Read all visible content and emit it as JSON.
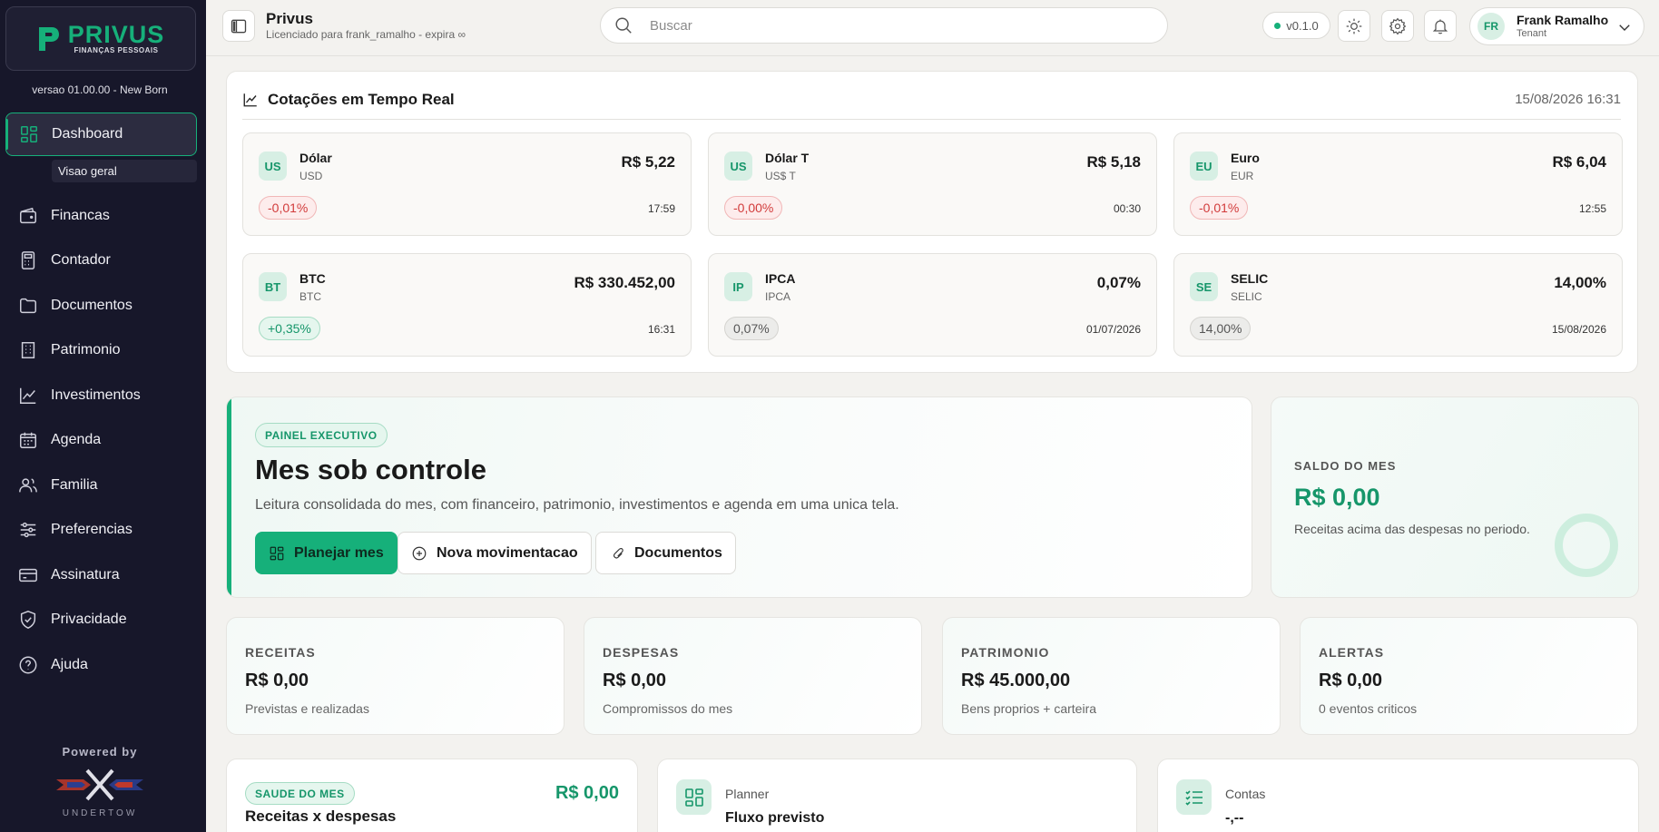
{
  "brand": {
    "logo_title": "PRIVUS",
    "logo_subtitle": "FINANÇAS PESSOAIS",
    "version_label": "versao 01.00.00 - New Born",
    "accent_color": "#16b07a"
  },
  "sidebar": {
    "active_item": "Dashboard",
    "subitem": "Visao geral",
    "items": [
      {
        "label": "Financas",
        "icon": "wallet-icon"
      },
      {
        "label": "Contador",
        "icon": "calculator-icon"
      },
      {
        "label": "Documentos",
        "icon": "folder-icon"
      },
      {
        "label": "Patrimonio",
        "icon": "building-icon"
      },
      {
        "label": "Investimentos",
        "icon": "chart-line-icon"
      },
      {
        "label": "Agenda",
        "icon": "calendar-icon"
      },
      {
        "label": "Familia",
        "icon": "users-icon"
      },
      {
        "label": "Preferencias",
        "icon": "sliders-icon"
      },
      {
        "label": "Assinatura",
        "icon": "credit-card-icon"
      },
      {
        "label": "Privacidade",
        "icon": "shield-check-icon"
      },
      {
        "label": "Ajuda",
        "icon": "help-circle-icon"
      }
    ],
    "powered_by": "Powered by",
    "powered_brand": "UNDERTOW"
  },
  "header": {
    "app_name": "Privus",
    "license": "Licenciado para frank_ramalho - expira ∞",
    "search_placeholder": "Buscar",
    "version": "v0.1.0",
    "user": {
      "initials": "FR",
      "name": "Frank Ramalho",
      "role": "Tenant"
    }
  },
  "quotes": {
    "title": "Cotações em Tempo Real",
    "timestamp": "15/08/2026 16:31",
    "items": [
      {
        "badge": "US",
        "name": "Dólar",
        "code": "USD",
        "value": "R$ 5,22",
        "change": "-0,01%",
        "trend": "neg",
        "time": "17:59"
      },
      {
        "badge": "US",
        "name": "Dólar T",
        "code": "US$ T",
        "value": "R$ 5,18",
        "change": "-0,00%",
        "trend": "neg",
        "time": "00:30"
      },
      {
        "badge": "EU",
        "name": "Euro",
        "code": "EUR",
        "value": "R$ 6,04",
        "change": "-0,01%",
        "trend": "neg",
        "time": "12:55"
      },
      {
        "badge": "BT",
        "name": "BTC",
        "code": "BTC",
        "value": "R$ 330.452,00",
        "change": "+0,35%",
        "trend": "pos",
        "time": "16:31"
      },
      {
        "badge": "IP",
        "name": "IPCA",
        "code": "IPCA",
        "value": "0,07%",
        "change": "0,07%",
        "trend": "neu",
        "time": "01/07/2026"
      },
      {
        "badge": "SE",
        "name": "SELIC",
        "code": "SELIC",
        "value": "14,00%",
        "change": "14,00%",
        "trend": "neu",
        "time": "15/08/2026"
      }
    ]
  },
  "executive": {
    "tag": "PAINEL EXECUTIVO",
    "title": "Mes sob controle",
    "description": "Leitura consolidada do mes, com financeiro, patrimonio, investimentos e agenda em uma unica tela.",
    "buttons": {
      "plan": "Planejar mes",
      "new": "Nova movimentacao",
      "docs": "Documentos"
    }
  },
  "saldo": {
    "label": "SALDO DO MES",
    "value": "R$ 0,00",
    "description": "Receitas acima das despesas no periodo."
  },
  "stats": [
    {
      "label": "RECEITAS",
      "value": "R$ 0,00",
      "description": "Previstas e realizadas"
    },
    {
      "label": "DESPESAS",
      "value": "R$ 0,00",
      "description": "Compromissos do mes"
    },
    {
      "label": "PATRIMONIO",
      "value": "R$ 45.000,00",
      "description": "Bens proprios + carteira"
    },
    {
      "label": "ALERTAS",
      "value": "R$ 0,00",
      "description": "0 eventos criticos"
    }
  ],
  "bottom": {
    "health": {
      "tag": "SAUDE DO MES",
      "title": "Receitas x despesas",
      "value": "R$ 0,00"
    },
    "planner": {
      "small": "Planner",
      "big": "Fluxo previsto"
    },
    "contas": {
      "small": "Contas",
      "big": "-,--"
    }
  }
}
